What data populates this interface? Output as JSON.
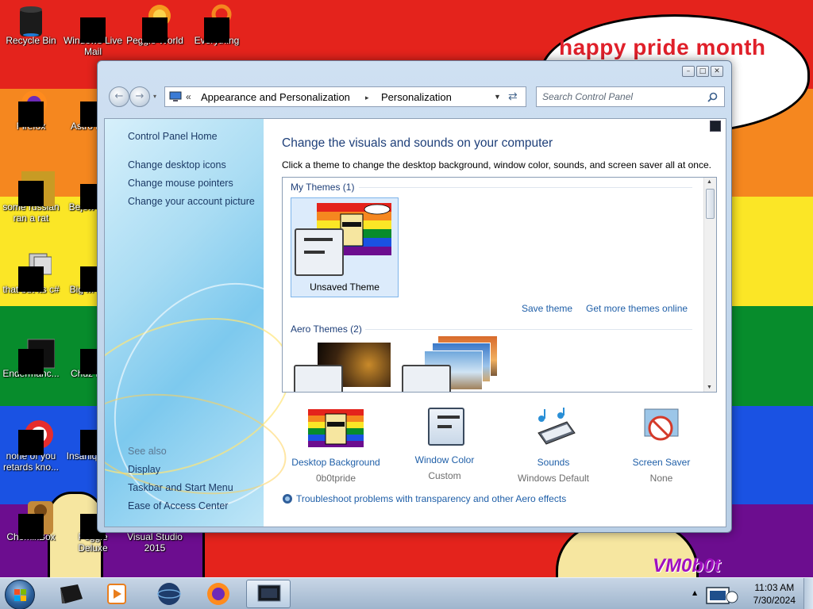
{
  "desktop": {
    "speech_text": "happy pride month",
    "watermark": "VM0b0t",
    "rainbow_colors": [
      "#e4231c",
      "#f5871f",
      "#fbe626",
      "#078c2c",
      "#1a52e3",
      "#6c0d8f"
    ],
    "icons": [
      {
        "label": "Recycle Bin",
        "icon": "recycle-bin-icon"
      },
      {
        "label": "Windows Live Mail",
        "icon": "mail-icon"
      },
      {
        "label": "Peggle World",
        "icon": "peggle-icon"
      },
      {
        "label": "Everything",
        "icon": "search-tool-icon"
      },
      {
        "label": "Firefox",
        "icon": "firefox-icon"
      },
      {
        "label": "Astro Delu",
        "icon": "game-icon"
      },
      {
        "label": "some russian ran a rat",
        "icon": "app-icon"
      },
      {
        "label": "Bejew Delu",
        "icon": "game-icon"
      },
      {
        "label": "that but its c#",
        "icon": "shortcut-icon"
      },
      {
        "label": "Big M Delu",
        "icon": "game-icon"
      },
      {
        "label": "Endermanc...",
        "icon": "window-icon"
      },
      {
        "label": "Chuz Delu",
        "icon": "game-icon"
      },
      {
        "label": "none of you retards kno...",
        "icon": "app-icon"
      },
      {
        "label": "Insaniq Delu",
        "icon": "game-icon"
      },
      {
        "label": "ChomikBox",
        "icon": "chomikbox-icon"
      },
      {
        "label": "Peggle Deluxe",
        "icon": "game-icon"
      },
      {
        "label": "Visual Studio 2015",
        "icon": "visual-studio-icon"
      }
    ]
  },
  "window": {
    "controls": {
      "minimize": "–",
      "maximize": "□",
      "close": "✕"
    },
    "nav": {
      "back": "←",
      "forward": "→"
    },
    "breadcrumb": [
      "Appearance and Personalization",
      "Personalization"
    ],
    "breadcrumb_sep": "▸",
    "breadcrumb_overflow": "«",
    "search_placeholder": "Search Control Panel",
    "sidebar": {
      "home": "Control Panel Home",
      "links": [
        "Change desktop icons",
        "Change mouse pointers",
        "Change your account picture"
      ],
      "see_also_title": "See also",
      "see_also": [
        "Display",
        "Taskbar and Start Menu",
        "Ease of Access Center"
      ]
    },
    "main": {
      "title": "Change the visuals and sounds on your computer",
      "description": "Click a theme to change the desktop background, window color, sounds, and screen saver all at once.",
      "my_themes_label": "My Themes (1)",
      "unsaved_theme_label": "Unsaved Theme",
      "save_theme": "Save theme",
      "get_more_themes": "Get more themes online",
      "aero_themes_label": "Aero Themes (2)"
    },
    "bottom": [
      {
        "label": "Desktop Background",
        "value": "0b0tpride"
      },
      {
        "label": "Window Color",
        "value": "Custom"
      },
      {
        "label": "Sounds",
        "value": "Windows Default"
      },
      {
        "label": "Screen Saver",
        "value": "None"
      }
    ],
    "troubleshoot": "Troubleshoot problems with transparency and other Aero effects"
  },
  "taskbar": {
    "time": "11:03 AM",
    "date": "7/30/2024",
    "tray_arrow": "▲"
  }
}
